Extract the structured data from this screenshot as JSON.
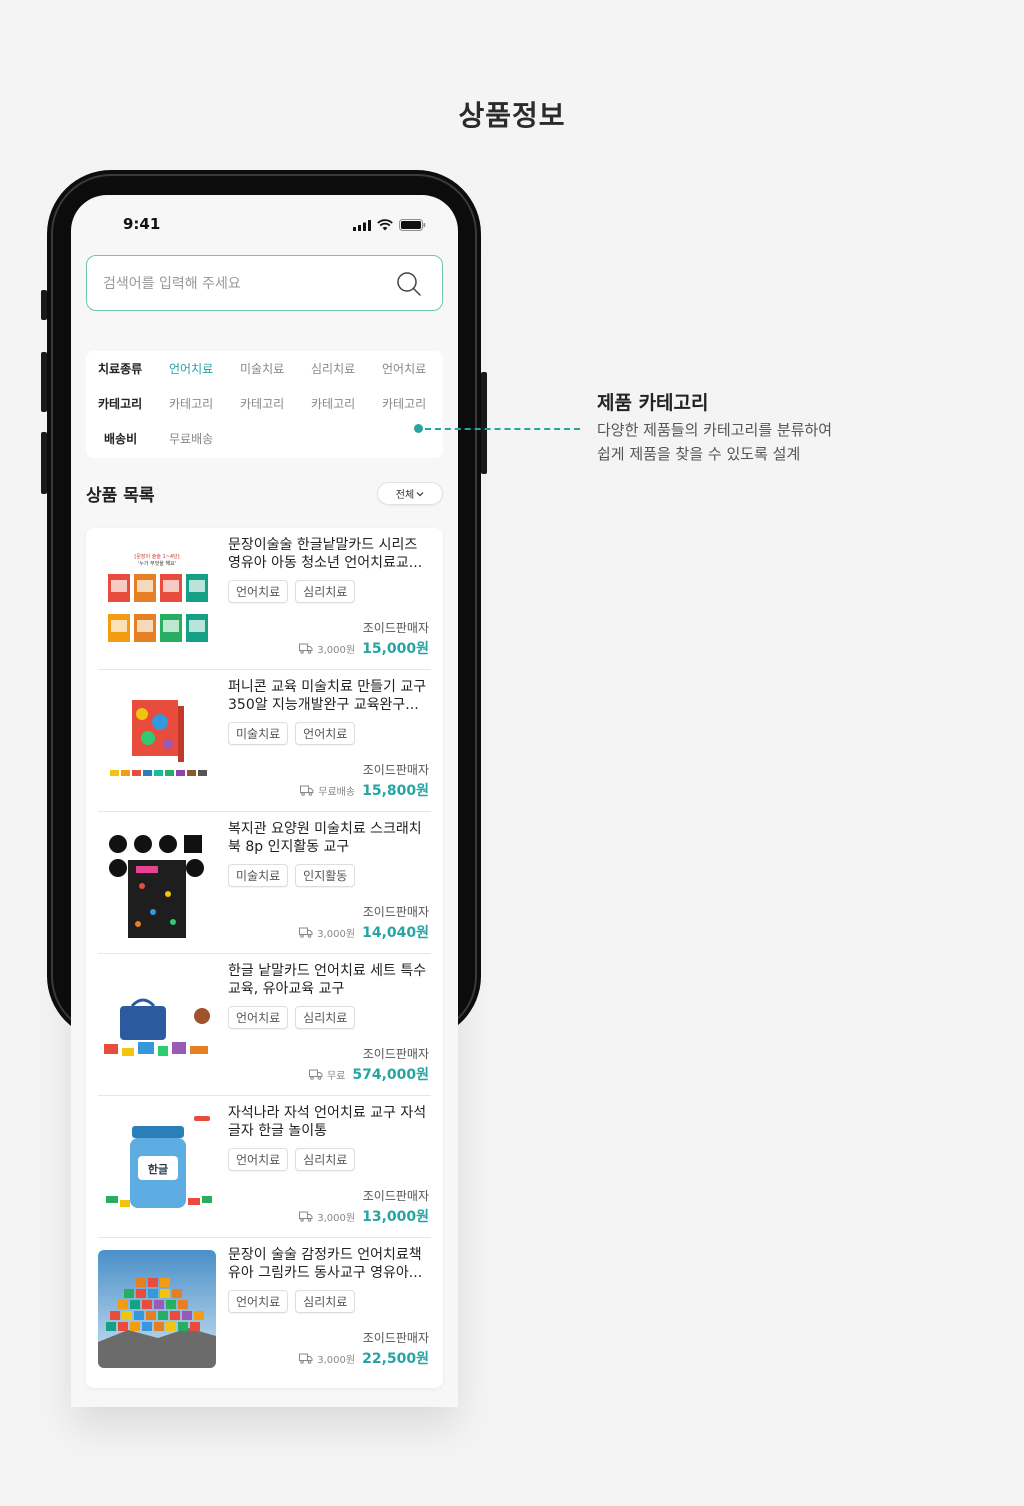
{
  "page_title": "상품정보",
  "status_bar": {
    "time": "9:41"
  },
  "search": {
    "placeholder": "검색어를 입력해 주세요"
  },
  "filters": {
    "rows": [
      {
        "label": "치료종류",
        "items": [
          "언어치료",
          "미술치료",
          "심리치료",
          "언어치료"
        ],
        "active_index": 0
      },
      {
        "label": "카테고리",
        "items": [
          "카테고리",
          "카테고리",
          "카테고리",
          "카테고리"
        ],
        "active_index": -1
      },
      {
        "label": "배송비",
        "items": [
          "무료배송"
        ],
        "active_index": -1
      }
    ]
  },
  "list": {
    "title": "상품 목록",
    "sort_label": "전체",
    "products": [
      {
        "name": "문장이술술 한글낱말카드 시리즈 영유아 아동 청소년 언어치료교...",
        "tags": [
          "언어치료",
          "심리치료"
        ],
        "seller": "조이드판매자",
        "shipping": "3,000원",
        "price": "15,000원",
        "thumb": "card-boxes",
        "thumb_caption": "[문장이 술술 1~4단] '누가 무엇을 해요'"
      },
      {
        "name": "퍼니콘 교육 미술치료 만들기 교구 350알 지능개발완구 교육완구...",
        "tags": [
          "미술치료",
          "언어치료"
        ],
        "seller": "조이드판매자",
        "shipping": "무료배송",
        "price": "15,800원",
        "thumb": "colorful-box"
      },
      {
        "name": "복지관 요양원 미술치료 스크래치북 8p 인지활동 교구",
        "tags": [
          "미술치료",
          "인지활동"
        ],
        "seller": "조이드판매자",
        "shipping": "3,000원",
        "price": "14,040원",
        "thumb": "scratch-book"
      },
      {
        "name": "한글 낱말카드 언어치료 세트 특수교육, 유아교육 교구",
        "tags": [
          "언어치료",
          "심리치료"
        ],
        "seller": "조이드판매자",
        "shipping": "무료",
        "price": "574,000원",
        "thumb": "bag-set"
      },
      {
        "name": "자석나라 자석 언어치료 교구 자석글자 한글 놀이통",
        "tags": [
          "언어치료",
          "심리치료"
        ],
        "seller": "조이드판매자",
        "shipping": "3,000원",
        "price": "13,000원",
        "thumb": "magnet-jar",
        "thumb_caption": "한글"
      },
      {
        "name": "문장이 술술 감정카드 언어치료책 유아 그림카드 동사교구 영유아...",
        "tags": [
          "언어치료",
          "심리치료"
        ],
        "seller": "조이드판매자",
        "shipping": "3,000원",
        "price": "22,500원",
        "thumb": "pyramid-sky"
      }
    ]
  },
  "annotation": {
    "title": "제품 카테고리",
    "desc_line1": "다양한 제품들의 카테고리를 분류하여",
    "desc_line2": "쉽게 제품을 찾을 수 있도록 설계"
  },
  "colors": {
    "accent": "#25a4a4",
    "search_border": "#6cc9a4",
    "background": "#f4f4f5"
  }
}
